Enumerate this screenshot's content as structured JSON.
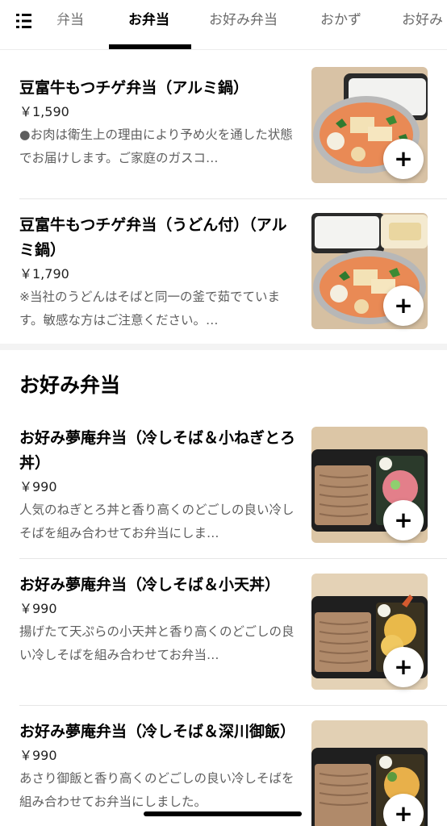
{
  "tabs": [
    {
      "label": "弁当",
      "active": false
    },
    {
      "label": "お弁当",
      "active": true
    },
    {
      "label": "お好み弁当",
      "active": false
    },
    {
      "label": "おかず",
      "active": false
    },
    {
      "label": "お好み",
      "active": false
    }
  ],
  "items_top": [
    {
      "name": "豆富牛もつチゲ弁当（アルミ鍋）",
      "price": "￥1,590",
      "description": "●お肉は衛生上の理由により予め火を通した状態でお届けします。ご家庭のガスコ…",
      "add_label": "+"
    },
    {
      "name": "豆富牛もつチゲ弁当（うどん付）（アルミ鍋）",
      "price": "￥1,790",
      "description": "※当社のうどんはそばと同一の釜で茹でています。敏感な方はご注意ください。…",
      "add_label": "+"
    }
  ],
  "section": {
    "title": "お好み弁当"
  },
  "items_section": [
    {
      "name": "お好み夢庵弁当（冷しそば＆小ねぎとろ丼）",
      "price": "￥990",
      "description": "人気のねぎとろ丼と香り高くのどごしの良い冷しそばを組み合わせてお弁当にしま…",
      "add_label": "+"
    },
    {
      "name": "お好み夢庵弁当（冷しそば＆小天丼）",
      "price": "￥990",
      "description": "揚げたて天ぷらの小天丼と香り高くのどごしの良い冷しそばを組み合わせてお弁当…",
      "add_label": "+"
    },
    {
      "name": "お好み夢庵弁当（冷しそば＆深川御飯）",
      "price": "￥990",
      "description": "あさり御飯と香り高くのどごしの良い冷しそばを組み合わせてお弁当にしました。",
      "add_label": "+"
    }
  ],
  "colors": {
    "active_tab": "#000000",
    "inactive_tab": "#6b6b6b",
    "description": "#5e5e5e",
    "divider": "#e6e6e6"
  },
  "icons": {
    "menu": "list-menu-icon",
    "add": "plus-icon"
  }
}
